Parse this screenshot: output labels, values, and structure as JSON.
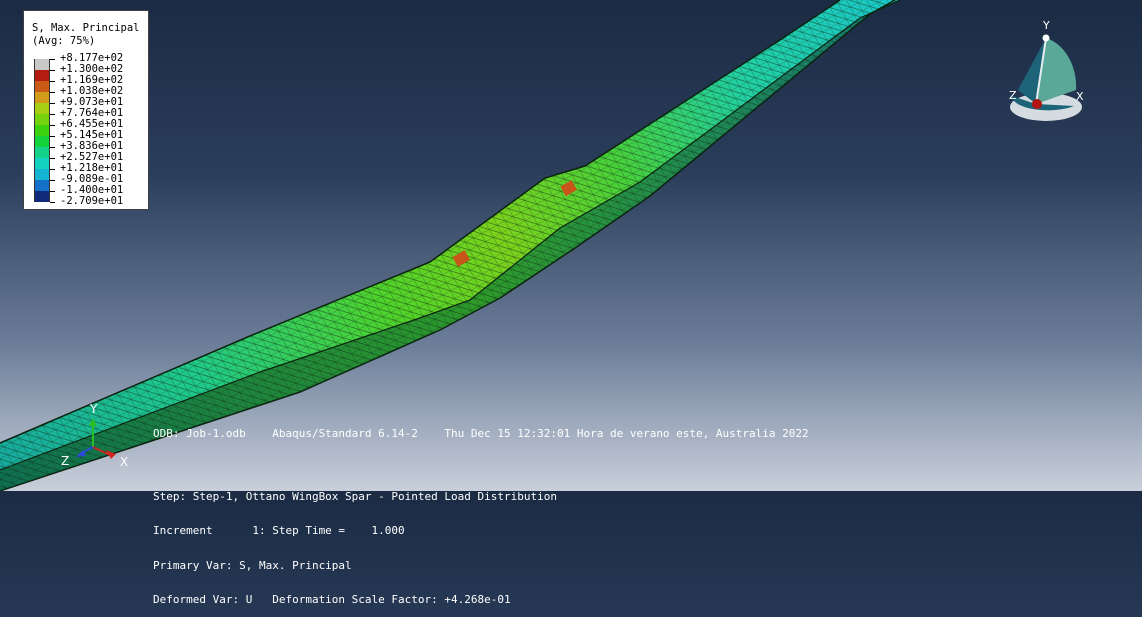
{
  "legend": {
    "title_line1": "S, Max. Principal",
    "title_line2": "(Avg: 75%)",
    "entries": [
      {
        "label": "+8.177e+02",
        "color": "#c8c8c8"
      },
      {
        "label": "+1.300e+02",
        "color": "#b41c10"
      },
      {
        "label": "+1.169e+02",
        "color": "#c85a14"
      },
      {
        "label": "+1.038e+02",
        "color": "#d29a1a"
      },
      {
        "label": "+9.073e+01",
        "color": "#a6cf14"
      },
      {
        "label": "+7.764e+01",
        "color": "#74d20e"
      },
      {
        "label": "+6.455e+01",
        "color": "#3cd20e"
      },
      {
        "label": "+5.145e+01",
        "color": "#14d23c"
      },
      {
        "label": "+3.836e+01",
        "color": "#14d28a"
      },
      {
        "label": "+2.527e+01",
        "color": "#14d2c0"
      },
      {
        "label": "+1.218e+01",
        "color": "#14b4d2"
      },
      {
        "label": "-9.089e-01",
        "color": "#1470c8"
      },
      {
        "label": "-1.400e+01",
        "color": "#102a7a"
      },
      {
        "label": "-2.709e+01",
        "color": ""
      }
    ]
  },
  "triad_top": {
    "y": "Y",
    "z": "Z",
    "x": "X"
  },
  "triad_bottom": {
    "y": "Y",
    "z": "Z",
    "x": "X"
  },
  "info": {
    "odb_line": "ODB: Job-1.odb    Abaqus/Standard 6.14-2    Thu Dec 15 12:32:01 Hora de verano este, Australia 2022",
    "step_line": "Step: Step-1, Ottano WingBox Spar - Pointed Load Distribution",
    "increment_line": "Increment      1: Step Time =    1.000",
    "primary_var_line": "Primary Var: S, Max. Principal",
    "deformed_var_line": "Deformed Var: U   Deformation Scale Factor: +4.268e-01"
  },
  "colors": {
    "mesh_line": "#0d2a12",
    "beam_high": "#72d21a",
    "beam_mid": "#1fd07a",
    "beam_low": "#14c8c4",
    "hotspot": "#c8561a"
  }
}
